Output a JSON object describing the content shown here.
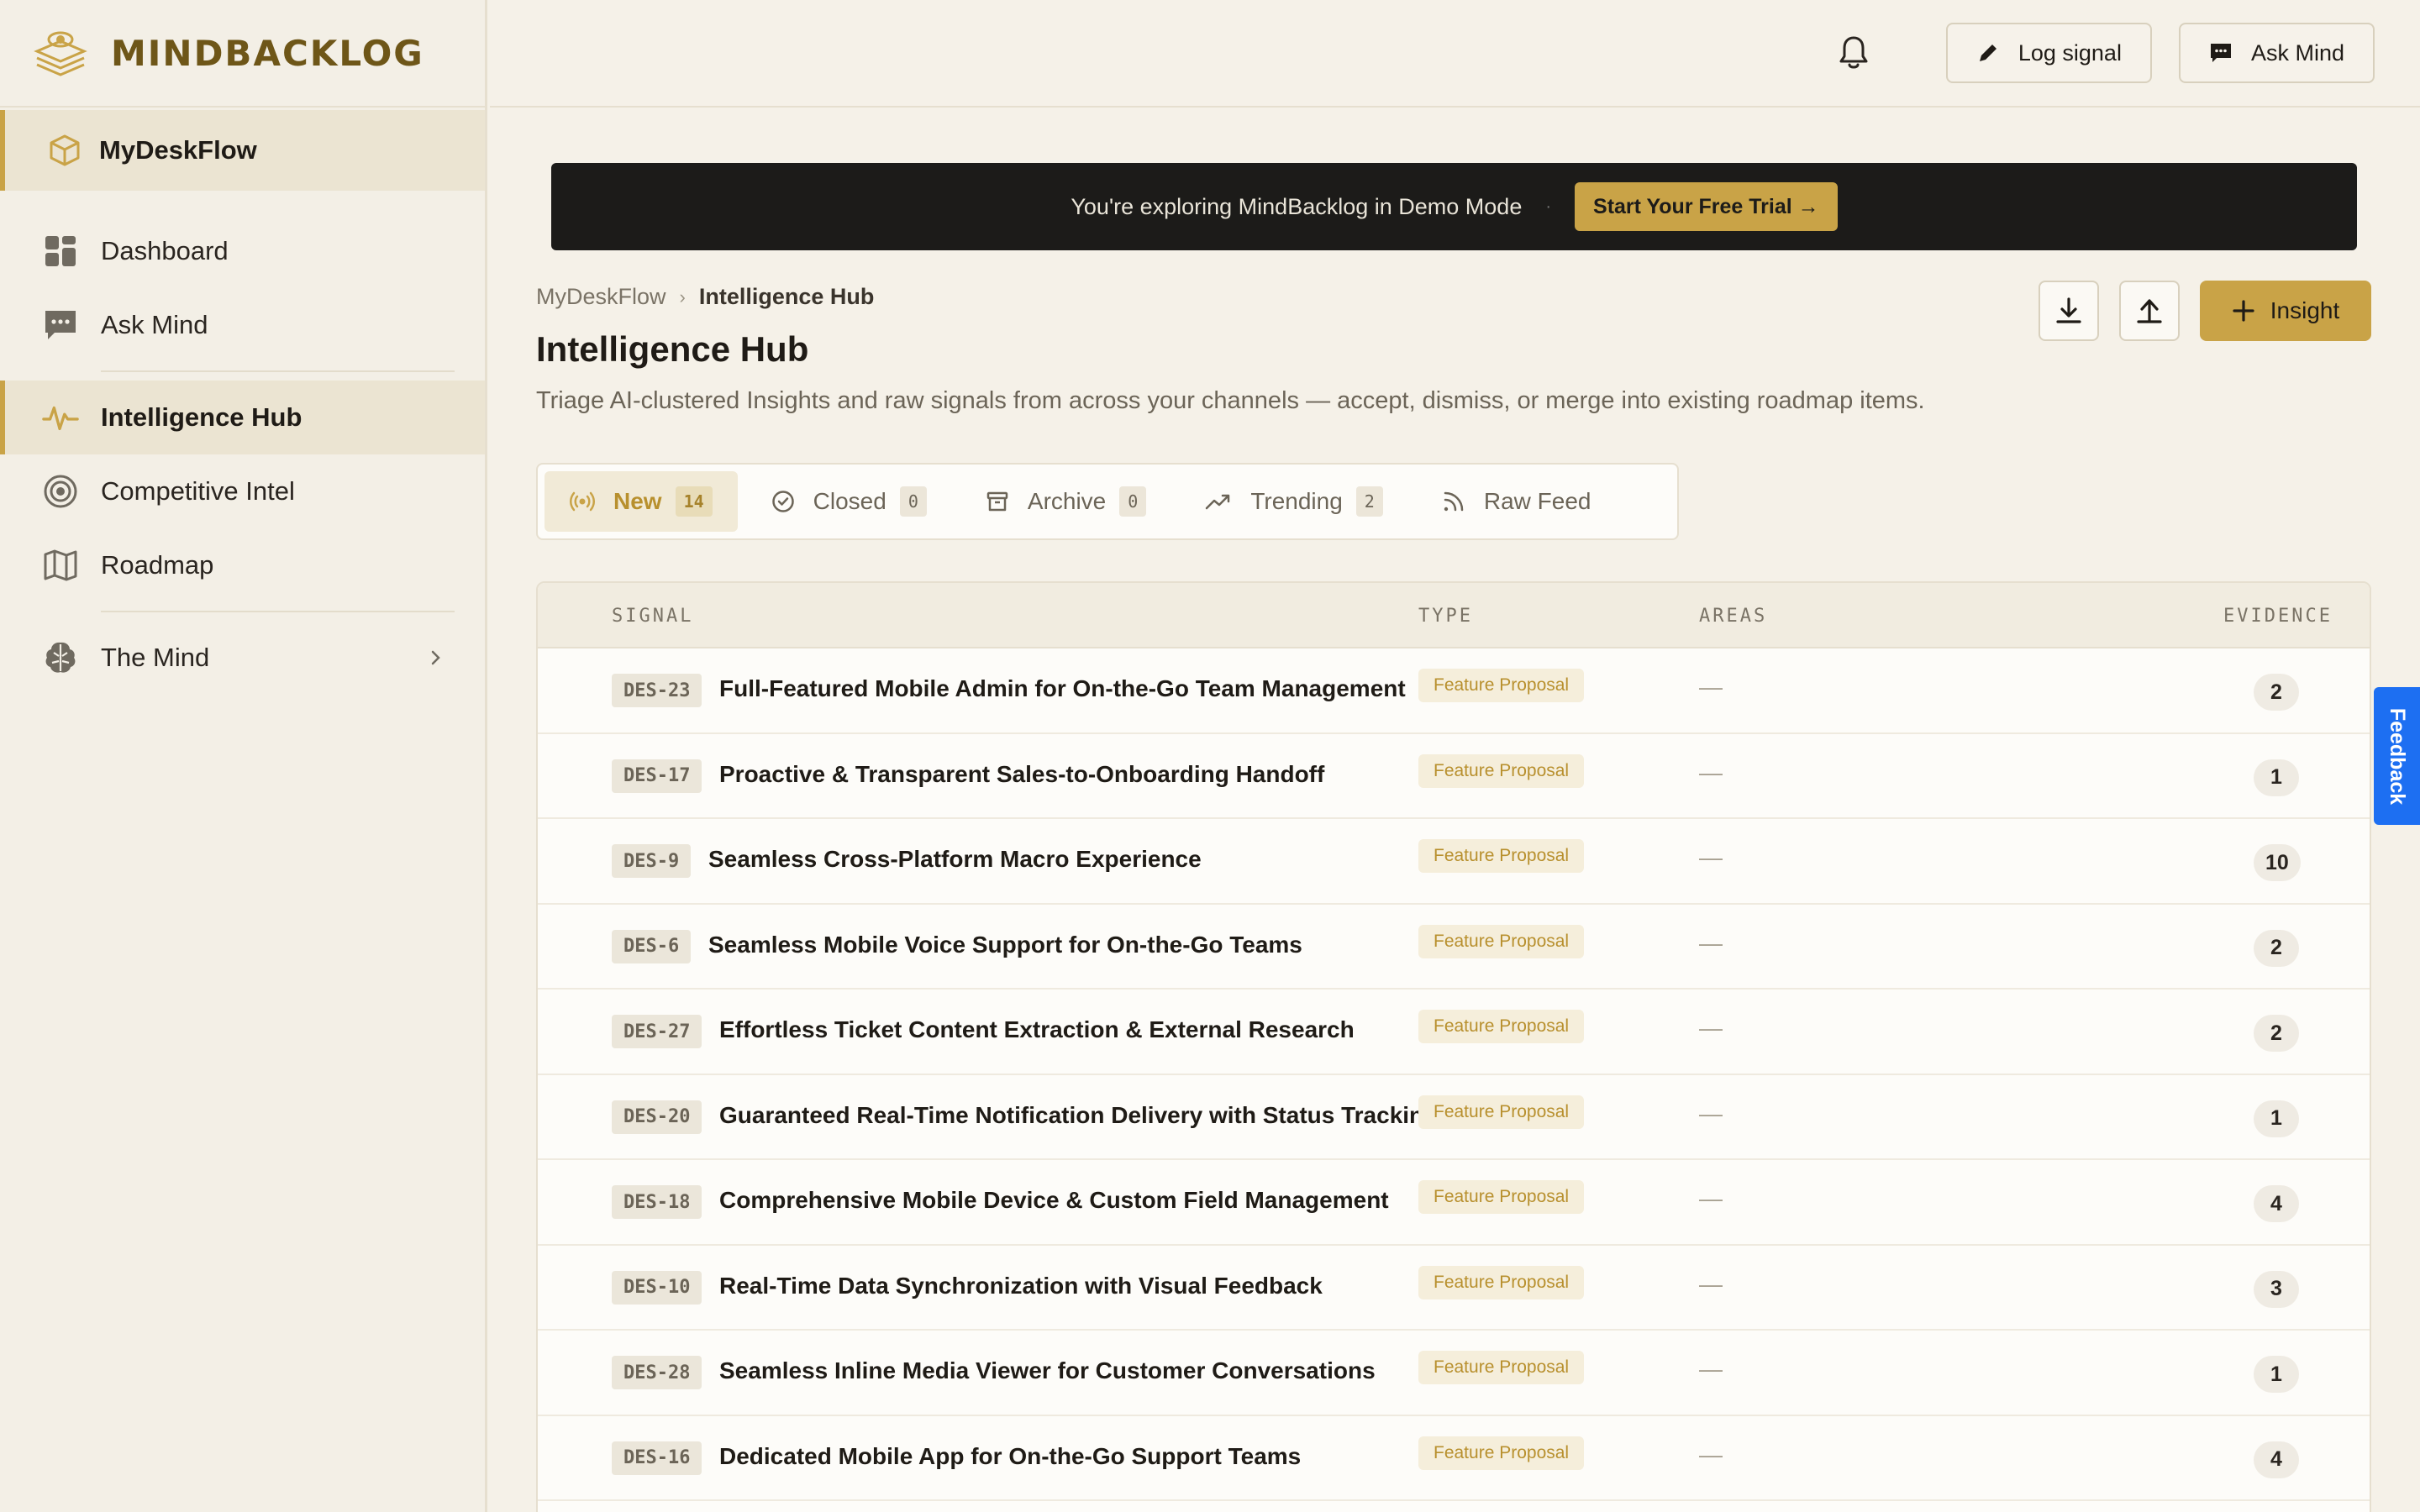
{
  "app": {
    "name": "MINDBACKLOG"
  },
  "sidebar": {
    "workspace": "MyDeskFlow",
    "items": [
      {
        "label": "Dashboard",
        "icon": "dashboard-icon"
      },
      {
        "label": "Ask Mind",
        "icon": "chat-icon"
      },
      {
        "label": "Intelligence Hub",
        "icon": "pulse-icon",
        "active": true
      },
      {
        "label": "Competitive Intel",
        "icon": "target-icon"
      },
      {
        "label": "Roadmap",
        "icon": "map-icon"
      },
      {
        "label": "The Mind",
        "icon": "brain-icon"
      }
    ]
  },
  "topbar": {
    "log_signal": "Log signal",
    "ask_mind": "Ask Mind"
  },
  "banner": {
    "text": "You're exploring MindBacklog in Demo Mode",
    "dot": "·",
    "cta": "Start Your Free Trial →"
  },
  "breadcrumb": {
    "parent": "MyDeskFlow",
    "separator": "›",
    "current": "Intelligence Hub"
  },
  "header": {
    "title": "Intelligence Hub",
    "description": "Triage AI-clustered Insights and raw signals from across your channels — accept, dismiss, or merge into existing roadmap items.",
    "insight_button": "Insight"
  },
  "tabs": [
    {
      "label": "New",
      "count": "14",
      "active": true
    },
    {
      "label": "Closed",
      "count": "0"
    },
    {
      "label": "Archive",
      "count": "0"
    },
    {
      "label": "Trending",
      "count": "2"
    },
    {
      "label": "Raw Feed"
    }
  ],
  "table": {
    "columns": {
      "signal": "SIGNAL",
      "type": "TYPE",
      "areas": "AREAS",
      "evidence": "EVIDENCE"
    },
    "rows": [
      {
        "id": "DES-23",
        "title": "Full-Featured Mobile Admin for On-the-Go Team Management",
        "type": "Feature Proposal",
        "areas": "—",
        "evidence": "2"
      },
      {
        "id": "DES-17",
        "title": "Proactive & Transparent Sales-to-Onboarding Handoff",
        "type": "Feature Proposal",
        "areas": "—",
        "evidence": "1"
      },
      {
        "id": "DES-9",
        "title": "Seamless Cross-Platform Macro Experience",
        "type": "Feature Proposal",
        "areas": "—",
        "evidence": "10"
      },
      {
        "id": "DES-6",
        "title": "Seamless Mobile Voice Support for On-the-Go Teams",
        "type": "Feature Proposal",
        "areas": "—",
        "evidence": "2"
      },
      {
        "id": "DES-27",
        "title": "Effortless Ticket Content Extraction & External Research",
        "type": "Feature Proposal",
        "areas": "—",
        "evidence": "2"
      },
      {
        "id": "DES-20",
        "title": "Guaranteed Real-Time Notification Delivery with Status Tracking",
        "type": "Feature Proposal",
        "areas": "—",
        "evidence": "1"
      },
      {
        "id": "DES-18",
        "title": "Comprehensive Mobile Device & Custom Field Management",
        "type": "Feature Proposal",
        "areas": "—",
        "evidence": "4"
      },
      {
        "id": "DES-10",
        "title": "Real-Time Data Synchronization with Visual Feedback",
        "type": "Feature Proposal",
        "areas": "—",
        "evidence": "3"
      },
      {
        "id": "DES-28",
        "title": "Seamless Inline Media Viewer for Customer Conversations",
        "type": "Feature Proposal",
        "areas": "—",
        "evidence": "1"
      },
      {
        "id": "DES-16",
        "title": "Dedicated Mobile App for On-the-Go Support Teams",
        "type": "Feature Proposal",
        "areas": "—",
        "evidence": "4"
      }
    ]
  },
  "feedback": {
    "label": "Feedback"
  },
  "colors": {
    "accent": "#c9a347",
    "brand_text": "#6e5618",
    "banner_bg": "#1c1b19",
    "feedback_bg": "#1d6ff2"
  }
}
